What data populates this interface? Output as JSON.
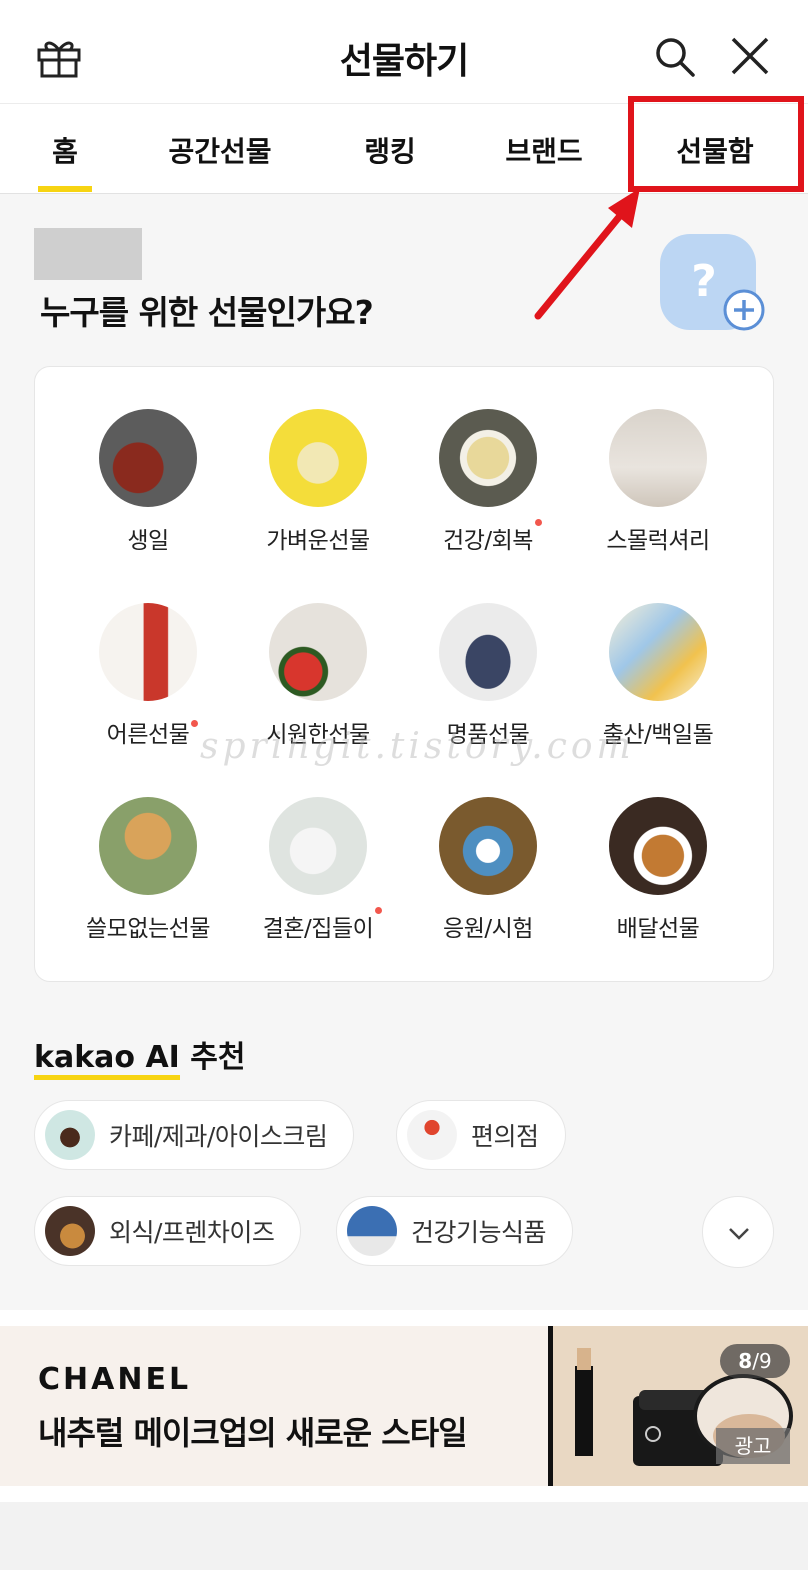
{
  "header": {
    "title": "선물하기"
  },
  "tabs": [
    {
      "label": "홈"
    },
    {
      "label": "공간선물"
    },
    {
      "label": "랭킹"
    },
    {
      "label": "브랜드"
    },
    {
      "label": "선물함"
    }
  ],
  "question": {
    "text": "누구를 위한 선물인가요?"
  },
  "categories": [
    {
      "label": "생일"
    },
    {
      "label": "가벼운선물"
    },
    {
      "label": "건강/회복"
    },
    {
      "label": "스몰럭셔리"
    },
    {
      "label": "어른선물"
    },
    {
      "label": "시원한선물"
    },
    {
      "label": "명품선물"
    },
    {
      "label": "출산/백일돌"
    },
    {
      "label": "쓸모없는선물"
    },
    {
      "label": "결혼/집들이"
    },
    {
      "label": "응원/시험"
    },
    {
      "label": "배달선물"
    }
  ],
  "watermark": "springit.tistory.com",
  "ai_section": {
    "brand": "kakao AI",
    "title": "추천"
  },
  "chips": [
    {
      "label": "카페/제과/아이스크림"
    },
    {
      "label": "편의점"
    },
    {
      "label": "외식/프렌차이즈"
    },
    {
      "label": "건강기능식품"
    }
  ],
  "banner": {
    "brand": "CHANEL",
    "headline": "내추럴 메이크업의 새로운 스타일",
    "page_current": "8",
    "page_total": "/9",
    "ad_label": "광고"
  },
  "colors": {
    "accent": "#f7d412",
    "highlight": "#e0141b",
    "dot": "#f2574d"
  }
}
